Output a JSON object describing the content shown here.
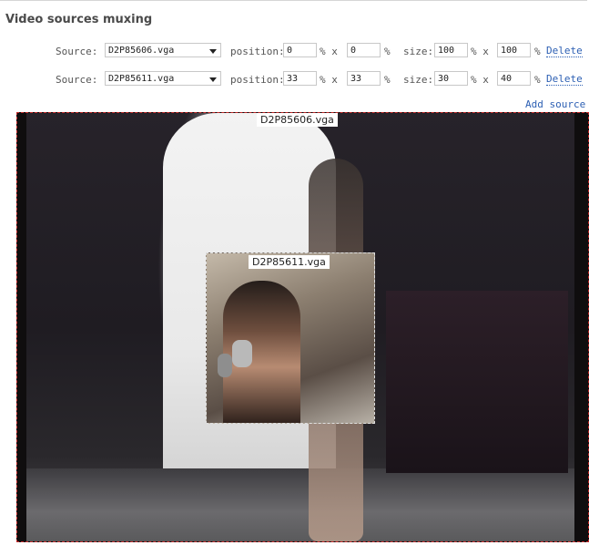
{
  "panel": {
    "title": "Video sources muxing",
    "add_source_label": "Add source"
  },
  "labels": {
    "source": "Source:",
    "position": "position:",
    "size": "size:",
    "pct_x": "% x",
    "pct": "%",
    "delete": "Delete"
  },
  "sources": [
    {
      "file": "D2P85606.vga",
      "pos_x": "0",
      "pos_y": "0",
      "size_w": "100",
      "size_h": "100"
    },
    {
      "file": "D2P85611.vga",
      "pos_x": "33",
      "pos_y": "33",
      "size_w": "30",
      "size_h": "40"
    }
  ],
  "preview": {
    "layer1_caption": "D2P85606.vga",
    "layer2_caption": "D2P85611.vga"
  },
  "colors": {
    "link": "#2c5fb3",
    "stage_border": "#c42a2a"
  }
}
